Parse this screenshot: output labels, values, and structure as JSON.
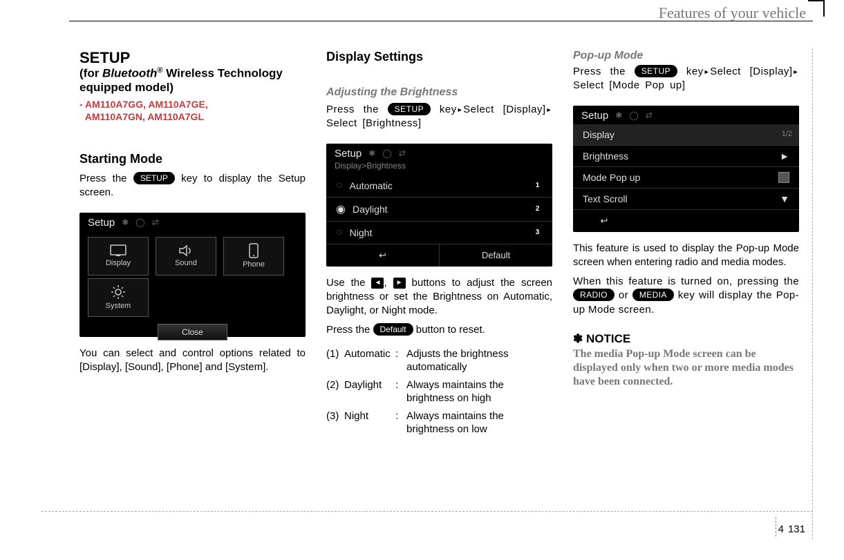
{
  "header": {
    "title": "Features of your vehicle"
  },
  "page_number": {
    "chapter": "4",
    "page": "131"
  },
  "col1": {
    "setup_heading": "SETUP",
    "sub_for": "(for ",
    "sub_bt": "Bluetooth",
    "sub_reg": "®",
    "sub_rest": " Wireless Technology equipped model)",
    "models_prefix": "- ",
    "models_line1": "AM110A7GG, AM110A7GE,",
    "models_line2": "AM110A7GN, AM110A7GL",
    "starting_mode": "Starting Mode",
    "press": "Press the ",
    "setup_key": "SETUP",
    "press_tail": " key to display the Setup screen.",
    "ss": {
      "title": "Setup",
      "tiles": {
        "display": "Display",
        "sound": "Sound",
        "phone": "Phone",
        "system": "System"
      },
      "close": "Close"
    },
    "footer_para": "You can select and control options related to [Display], [Sound], [Phone] and [System]."
  },
  "col2": {
    "heading": "Display Settings",
    "sub": "Adjusting the Brightness",
    "press": "Press the ",
    "setup_key": "SETUP",
    "key_word": " key",
    "select1": "Select [Display]",
    "select2": "Select [Brightness]",
    "ss": {
      "title": "Setup",
      "crumb": "Display>Brightness",
      "opts": {
        "auto": "Automatic",
        "day": "Daylight",
        "night": "Night"
      },
      "back_icon": "↩",
      "default": "Default"
    },
    "use_p1": "Use the ",
    "use_p2": ", ",
    "use_p3": " buttons to adjust the screen brightness or set the Brightness on Automatic, Daylight, or Night mode.",
    "press_default_1": "Press the ",
    "default_btn": "Default",
    "press_default_2": " button to reset.",
    "items": {
      "n1": "(1)",
      "t1": "Automatic",
      "d1": "Adjusts the brightness automatically",
      "n2": "(2)",
      "t2": "Daylight",
      "d2": "Always maintains the brightness on high",
      "n3": "(3)",
      "t3": "Night",
      "d3": "Always maintains the brightness on low"
    }
  },
  "col3": {
    "heading": "Pop-up Mode",
    "press": "Press the ",
    "setup_key": "SETUP",
    "key_word": " key",
    "select1": "Select [Display]",
    "select2": "Select [Mode Pop up]",
    "ss": {
      "title": "Setup",
      "display": "Display",
      "pagefrac": "1/2",
      "rows": {
        "brightness": "Brightness",
        "modepopup": "Mode Pop up",
        "textscroll": "Text Scroll"
      },
      "back_icon": "↩"
    },
    "para1": "This feature is used to display the Pop-up Mode screen when entering radio and media modes.",
    "para2a": "When this feature is turned on, pressing the ",
    "radio_key": "RADIO",
    "para2b": " or ",
    "media_key": "MEDIA",
    "para2c": " key will display the Pop-up Mode screen.",
    "notice_star": "✽",
    "notice": "NOTICE",
    "notice_body": "The media Pop-up Mode screen can be displayed only when two or more media modes have been connected."
  }
}
